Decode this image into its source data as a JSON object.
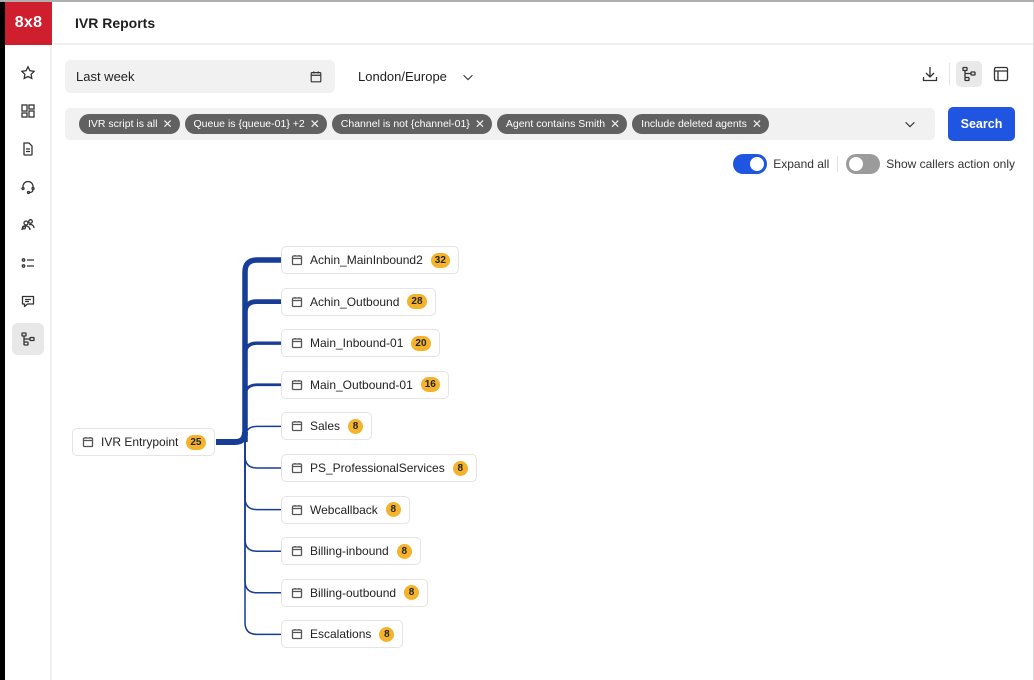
{
  "app": {
    "logo": "8x8",
    "title": "IVR Reports"
  },
  "sidebar": {
    "items": [
      {
        "name": "favorites",
        "icon": "star-icon",
        "active": false
      },
      {
        "name": "dashboards",
        "icon": "dashboard-icon",
        "active": false
      },
      {
        "name": "reports",
        "icon": "document-icon",
        "active": false
      },
      {
        "name": "agents",
        "icon": "headset-icon",
        "active": false
      },
      {
        "name": "groups",
        "icon": "users-icon",
        "active": false
      },
      {
        "name": "lists",
        "icon": "list-icon",
        "active": false
      },
      {
        "name": "messages",
        "icon": "chat-icon",
        "active": false
      },
      {
        "name": "ivr",
        "icon": "flow-icon",
        "active": true
      }
    ]
  },
  "filters": {
    "date_range": "Last week",
    "timezone": "London/Europe",
    "chips": [
      "IVR script is all",
      "Queue is {queue-01} +2",
      "Channel is not {channel-01}",
      "Agent contains Smith",
      "Include deleted agents"
    ],
    "search_label": "Search"
  },
  "toolbar": {
    "download": "download-icon",
    "tree_view": "flow-icon",
    "table_view": "panel-icon"
  },
  "toggles": {
    "expand_all": {
      "label": "Expand all",
      "on": true
    },
    "callers_only": {
      "label": "Show callers action only",
      "on": false
    }
  },
  "tree": {
    "root": {
      "label": "IVR Entrypoint",
      "count": "25"
    },
    "children": [
      {
        "label": "Achin_MainInbound2",
        "count": "32"
      },
      {
        "label": "Achin_Outbound",
        "count": "28"
      },
      {
        "label": "Main_Inbound-01",
        "count": "20"
      },
      {
        "label": "Main_Outbound-01",
        "count": "16"
      },
      {
        "label": "Sales",
        "count": "8"
      },
      {
        "label": "PS_ProfessionalServices",
        "count": "8"
      },
      {
        "label": "Webcallback",
        "count": "8"
      },
      {
        "label": "Billing-inbound",
        "count": "8"
      },
      {
        "label": "Billing-outbound",
        "count": "8"
      },
      {
        "label": "Escalations",
        "count": "8"
      }
    ]
  },
  "colors": {
    "brand_red": "#cf1f2e",
    "primary_blue": "#1f55e0",
    "tree_line": "#173d96",
    "badge": "#f4b32a",
    "chip": "#616161"
  }
}
